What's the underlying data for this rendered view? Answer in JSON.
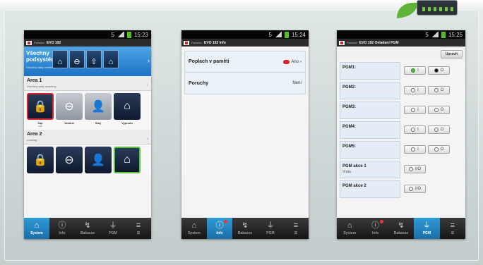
{
  "phone1": {
    "status_time": "15:23",
    "app_title": "EVO 192",
    "app_tag": "Paradox",
    "banner": {
      "title": "Všechny podsystémy",
      "subtitle": "Všechny cisty uzavřeny"
    },
    "banner_buttons": [
      "⌂",
      "⊖",
      "⇧",
      "⌂"
    ],
    "area1": {
      "title": "Area 1",
      "subtitle": "Všechny cisty uzavřeny"
    },
    "tiles1": [
      {
        "label": "Zap",
        "sub": "Stav"
      },
      {
        "label": "Vasbné",
        "sub": ""
      },
      {
        "label": "Stay",
        "sub": ""
      },
      {
        "label": "Vypnuto",
        "sub": ""
      }
    ],
    "area2": {
      "title": "Area 2",
      "subtitle": "Loading..."
    },
    "nav": [
      "System",
      "Info",
      "Bakasse",
      "PGM",
      "☰"
    ]
  },
  "phone2": {
    "status_time": "15:24",
    "app_title": "EVO 192 Info",
    "app_tag": "Paradox",
    "rows": [
      {
        "label": "Poplach v paměti",
        "value": "Ano"
      },
      {
        "label": "Poruchy",
        "value": "Není"
      }
    ],
    "nav": [
      "System",
      "Info",
      "Bakasse",
      "PGM",
      "☰"
    ]
  },
  "phone3": {
    "status_time": "15:25",
    "app_title": "EVO 192 Ovladani PGM",
    "app_tag": "Paradox",
    "edit_button": "Upravit",
    "pgms": [
      {
        "label": "PGM1:",
        "sub": "",
        "state": [
          "I",
          "O"
        ]
      },
      {
        "label": "PGM2:",
        "sub": "",
        "state": [
          "I",
          "O"
        ]
      },
      {
        "label": "PGM3:",
        "sub": "",
        "state": [
          "I",
          "O"
        ]
      },
      {
        "label": "PGM4:",
        "sub": "",
        "state": [
          "I",
          "O"
        ]
      },
      {
        "label": "PGM5:",
        "sub": "",
        "state": [
          "I",
          "O"
        ]
      },
      {
        "label": "PGM akce 1",
        "sub": "Vrata",
        "state": [
          "I/O"
        ]
      },
      {
        "label": "PGM akce 2",
        "sub": "",
        "state": [
          "I/O"
        ]
      }
    ],
    "nav": [
      "System",
      "Info",
      "Bakasse",
      "PGM",
      "☰"
    ]
  },
  "colors": {
    "accent_blue": "#2f9ad6",
    "alarm_red": "#d8232a",
    "ok_green": "#4fc13d"
  }
}
